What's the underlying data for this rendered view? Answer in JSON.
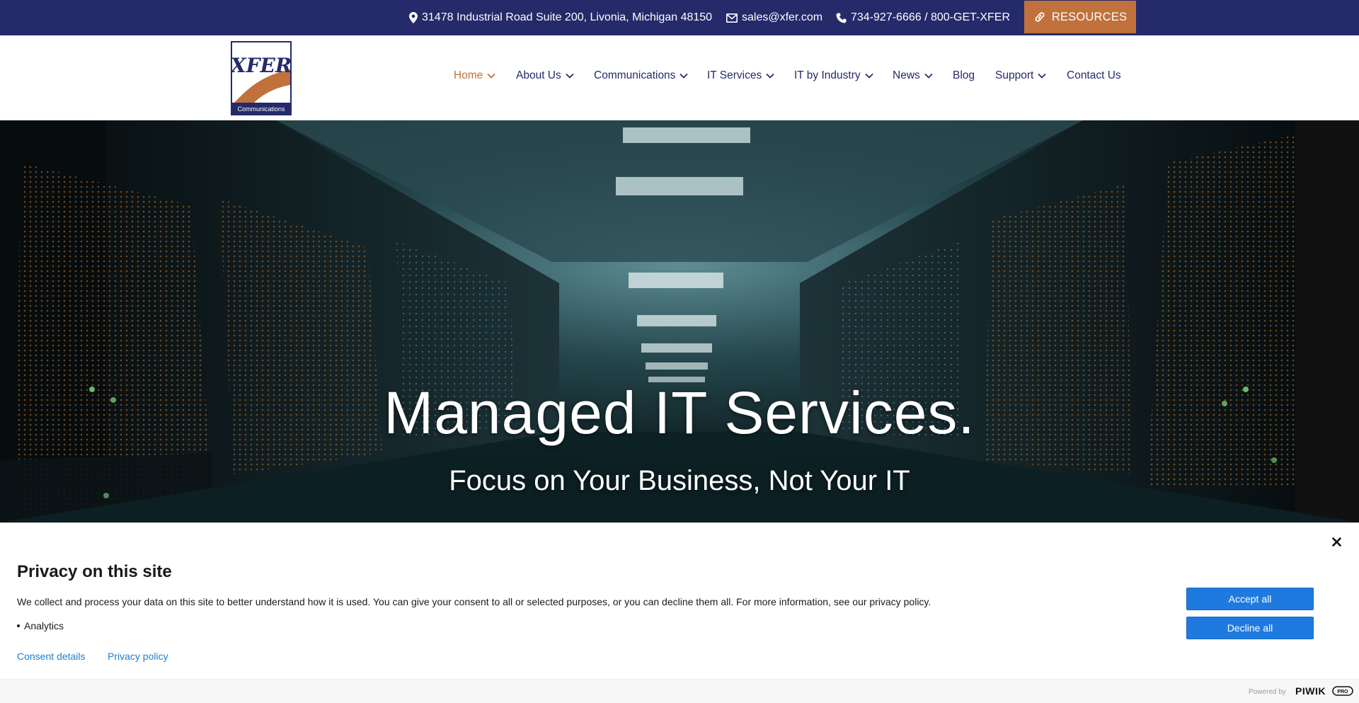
{
  "topbar": {
    "address": "31478 Industrial Road Suite 200, Livonia, Michigan 48150",
    "email": "sales@xfer.com",
    "phone": "734-927-6666 / 800-GET-XFER",
    "resources_label": "RESOURCES",
    "background_color": "#252a6b",
    "accent_color": "#c0713c"
  },
  "logo": {
    "text": "XFER",
    "subtext": "Communications"
  },
  "nav": {
    "items": [
      {
        "label": "Home",
        "has_dropdown": true,
        "active": true
      },
      {
        "label": "About Us",
        "has_dropdown": true
      },
      {
        "label": "Communications",
        "has_dropdown": true
      },
      {
        "label": "IT Services",
        "has_dropdown": true
      },
      {
        "label": "IT by Industry",
        "has_dropdown": true
      },
      {
        "label": "News",
        "has_dropdown": true
      },
      {
        "label": "Blog",
        "has_dropdown": false
      },
      {
        "label": "Support",
        "has_dropdown": true
      },
      {
        "label": "Contact Us",
        "has_dropdown": false
      }
    ]
  },
  "hero": {
    "title": "Managed IT Services.",
    "subtitle": "Focus on Your Business, Not Your IT"
  },
  "privacy": {
    "title": "Privacy on this site",
    "text": "We collect and process your data on this site to better understand how it is used. You can give your consent to all or selected purposes, or you can decline them all. For more information, see our privacy policy.",
    "purposes": [
      "Analytics"
    ],
    "consent_details_link": "Consent details",
    "privacy_policy_link": "Privacy policy",
    "accept_label": "Accept all",
    "decline_label": "Decline all",
    "powered_by": "Powered by",
    "vendor_logo": "PIWIK PRO",
    "button_color": "#1f7ae0"
  }
}
